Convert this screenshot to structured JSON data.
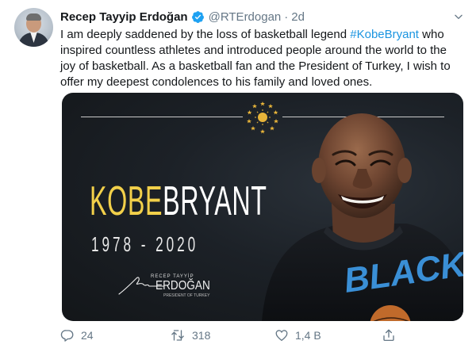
{
  "tweet": {
    "author_name": "Recep Tayyip Erdoğan",
    "handle": "@RTErdogan",
    "separator": "·",
    "time": "2d",
    "text_before": "I am deeply saddened by the loss of basketball legend ",
    "hashtag": "#KobeBryant",
    "text_after": " who inspired countless athletes and introduced people around the world to the joy of basketball. As a basketball fan and the President of Turkey, I wish to offer my deepest condolences to his family and loved ones."
  },
  "media": {
    "title_first": "KOBE",
    "title_last": "BRYANT",
    "years": "1978 - 2020",
    "signature_small": "RECEP TAYYİP",
    "signature_big": "ERDOĞAN",
    "signature_sub": "PRESIDENT OF TURKEY",
    "jersey_text": "BLACK"
  },
  "actions": {
    "replies": "24",
    "retweets": "318",
    "likes": "1,4 B"
  },
  "icons": {
    "verified": "verified-badge-icon",
    "caret": "chevron-down-icon",
    "reply": "reply-icon",
    "retweet": "retweet-icon",
    "like": "heart-icon",
    "share": "share-icon"
  },
  "colors": {
    "accent": "#1b95e0",
    "text": "#14171a",
    "secondary": "#657786",
    "kobe_yellow": "#f2d04a"
  }
}
